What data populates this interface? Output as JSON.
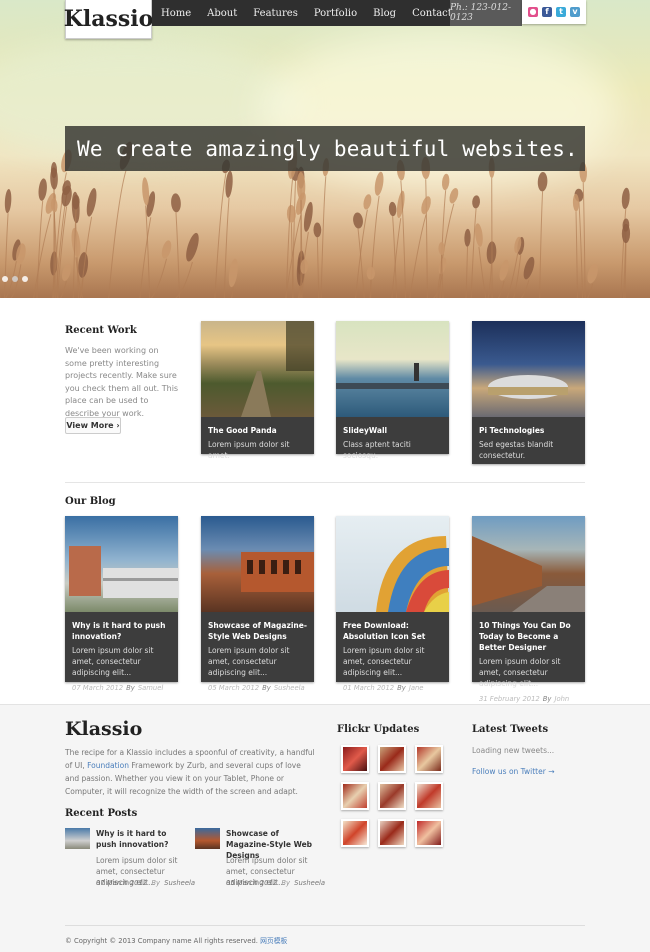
{
  "header": {
    "logo": "Klassio",
    "nav": [
      "Home",
      "About",
      "Features",
      "Portfolio",
      "Blog",
      "Contact"
    ],
    "phone": "Ph.: 123-012-0123",
    "social": [
      "dribbble-icon",
      "facebook-icon",
      "twitter-icon",
      "vimeo-icon"
    ]
  },
  "hero": {
    "tagline": "We create amazingly beautiful websites.",
    "slider_dots": 3,
    "active_dot": 1
  },
  "recent_work": {
    "heading": "Recent Work",
    "intro": "We've been working on some pretty interesting projects recently. Make sure you check them all out. This place can be used to describe your work.",
    "button": "View More ›",
    "items": [
      {
        "title": "The Good Panda",
        "desc": "Lorem ipsum dolor sit amet."
      },
      {
        "title": "SlideyWall",
        "desc": "Class aptent taciti sociosqu."
      },
      {
        "title": "Pi Technologies",
        "desc": "Sed egestas blandit consectetur."
      }
    ]
  },
  "blog": {
    "heading": "Our Blog",
    "posts": [
      {
        "title": "Why is it hard to push innovation?",
        "desc": "Lorem ipsum dolor sit amet, consectetur adipiscing elit...",
        "date": "07 March 2012",
        "by": "By",
        "author": "Samuel"
      },
      {
        "title": "Showcase of Magazine-Style Web Designs",
        "desc": "Lorem ipsum dolor sit amet, consectetur adipiscing elit...",
        "date": "05 March 2012",
        "by": "By",
        "author": "Susheela"
      },
      {
        "title": "Free Download: Absolution Icon Set",
        "desc": "Lorem ipsum dolor sit amet, consectetur adipiscing elit...",
        "date": "01 March 2012",
        "by": "By",
        "author": "Jane"
      },
      {
        "title": "10 Things You Can Do Today to Become a Better Designer",
        "desc": "Lorem ipsum dolor sit amet, consectetur adipiscing elit...",
        "date": "31 February 2012",
        "by": "By",
        "author": "John"
      }
    ]
  },
  "footer": {
    "logo": "Klassio",
    "about_pre": "The recipe for a Klassio includes a spoonful of creativity, a handful of UI,",
    "about_link": "Foundation",
    "about_post": "Framework by Zurb, and several cups of love and passion. Whether you view it on your Tablet, Phone or Computer, it will recognize the width of the screen and adapt.",
    "recent_posts_heading": "Recent Posts",
    "recent_posts": [
      {
        "title": "Why is it hard to push innovation?",
        "desc": "Lorem ipsum dolor sit amet, consectetur adipiscing elit...",
        "date": "07 March 2012",
        "by": "By",
        "author": "Susheela"
      },
      {
        "title": "Showcase of Magazine-Style Web Designs",
        "desc": "Lorem ipsum dolor sit amet, consectetur adipiscing elit...",
        "date": "05 March 2012",
        "by": "By",
        "author": "Susheela"
      }
    ],
    "flickr_heading": "Flickr Updates",
    "tweets_heading": "Latest Tweets",
    "tweets_loading": "Loading new tweets...",
    "tweets_follow": "Follow us on Twitter →",
    "copyright": "© Copyright © 2013 Company name All rights reserved.",
    "copyright_link": "网页模板"
  },
  "colors": {
    "nav_bg": "#2f2f2f",
    "card_bg": "#3d3d3d",
    "link": "#4a7ebb",
    "footer_bg": "#f5f5f5"
  }
}
